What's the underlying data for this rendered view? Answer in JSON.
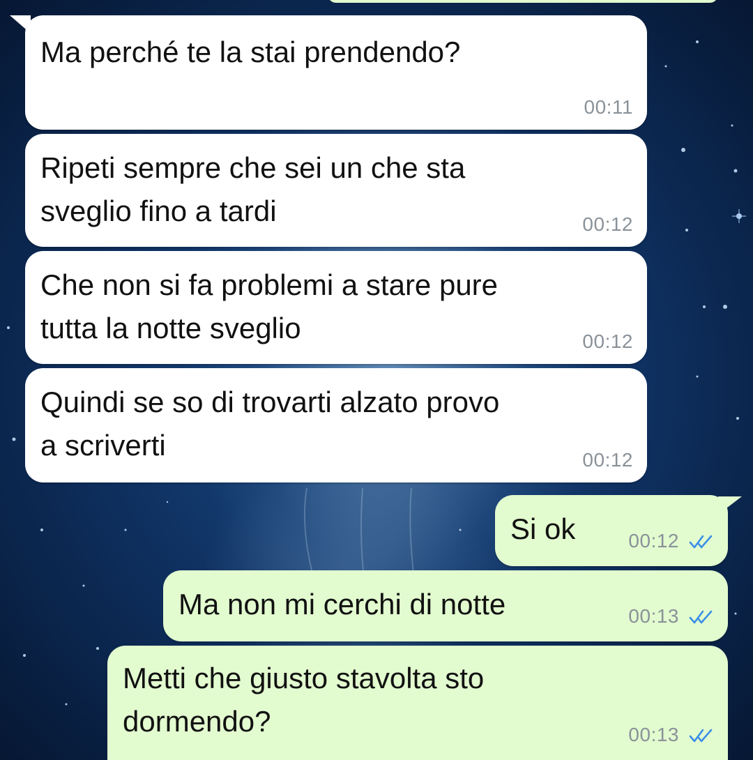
{
  "chat": {
    "messages": [
      {
        "direction": "in",
        "text": "Ma perché te la stai prendendo?",
        "time": "00:11"
      },
      {
        "direction": "in",
        "text": "Ripeti sempre che sei un che sta\nsveglio fino a tardi",
        "time": "00:12"
      },
      {
        "direction": "in",
        "text": "Che non si fa problemi a stare pure\ntutta la notte sveglio",
        "time": "00:12"
      },
      {
        "direction": "in",
        "text": "Quindi se so di trovarti alzato provo\na scriverti",
        "time": "00:12"
      },
      {
        "direction": "out",
        "text": "Si ok",
        "time": "00:12",
        "status": "read"
      },
      {
        "direction": "out",
        "text": "Ma non mi cerchi di notte",
        "time": "00:13",
        "status": "read"
      },
      {
        "direction": "out",
        "text": "Metti che giusto stavolta sto\ndormendo?",
        "time": "00:13",
        "status": "read"
      }
    ]
  },
  "colors": {
    "incoming_bubble": "#ffffff",
    "outgoing_bubble": "#e2fbcf",
    "read_ticks": "#3a8ee6",
    "timestamp": "#8a9299"
  },
  "icons": {
    "read_receipt": "double-check-icon"
  }
}
